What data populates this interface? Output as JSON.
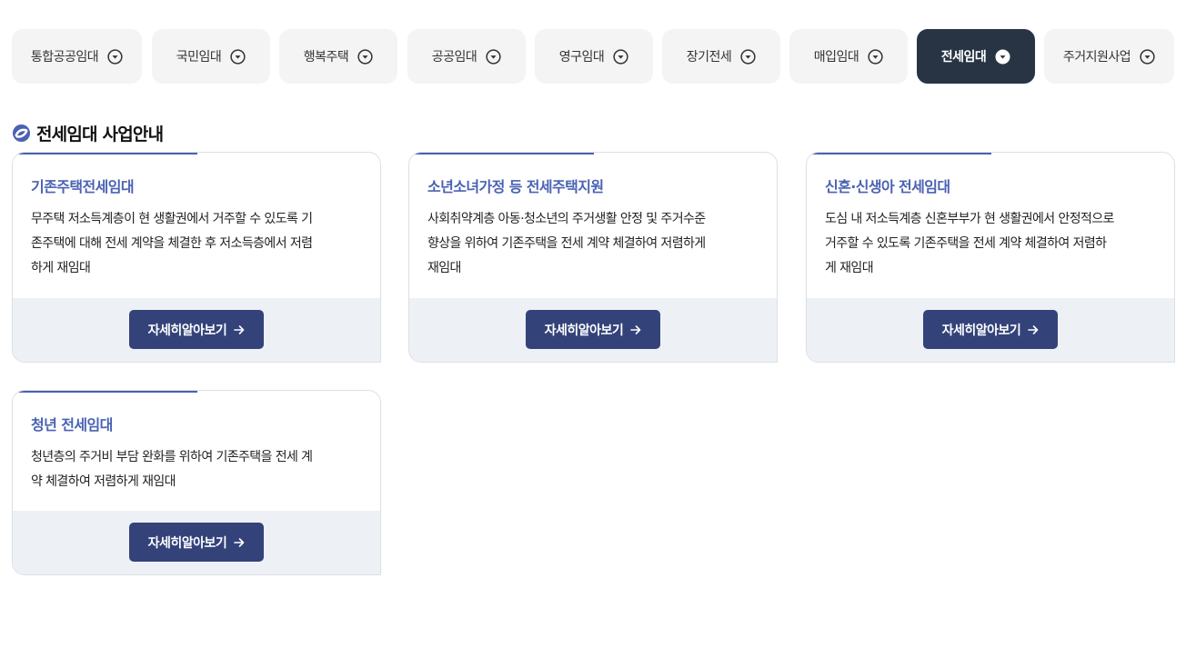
{
  "tabs": [
    {
      "label": "통합공공임대",
      "icon": "chevron-down-circle-icon",
      "active": false
    },
    {
      "label": "국민임대",
      "icon": "chevron-down-circle-icon",
      "active": false
    },
    {
      "label": "행복주택",
      "icon": "chevron-down-circle-icon",
      "active": false
    },
    {
      "label": "공공임대",
      "icon": "chevron-down-circle-icon",
      "active": false
    },
    {
      "label": "영구임대",
      "icon": "chevron-down-circle-icon",
      "active": false
    },
    {
      "label": "장기전세",
      "icon": "chevron-down-circle-icon",
      "active": false
    },
    {
      "label": "매입임대",
      "icon": "chevron-down-circle-icon",
      "active": false
    },
    {
      "label": "전세임대",
      "icon": "chevron-down-circle-icon",
      "active": true
    },
    {
      "label": "주거지원사업",
      "icon": "chevron-down-circle-icon",
      "active": false
    }
  ],
  "section": {
    "title": "전세임대 사업안내",
    "icon": "link-circle-icon"
  },
  "cards": [
    {
      "title": "기존주택전세임대",
      "desc_lines": [
        "무주택 저소득계층이 현 생활권에서 거주할 수 있도록 기",
        "존주택에 대해 전세 계약을 체결한 후 저소득층에서 저렴",
        "하게 재임대"
      ],
      "button_label": "자세히알아보기"
    },
    {
      "title": "소년소녀가정 등 전세주택지원",
      "desc_lines": [
        "사회취약계층 아동·청소년의 주거생활 안정 및 주거수준",
        "향상을 위하여 기존주택을 전세 계약 체결하여 저렴하게",
        "재임대"
      ],
      "button_label": "자세히알아보기"
    },
    {
      "title": "신혼·신생아 전세임대",
      "desc_lines": [
        "도심 내 저소득계층 신혼부부가 현 생활권에서 안정적으로",
        "거주할 수 있도록 기존주택을 전세 계약 체결하여 저렴하",
        "게 재임대"
      ],
      "button_label": "자세히알아보기"
    },
    {
      "title": "청년 전세임대",
      "desc_lines": [
        "청년층의 주거비 부담 완화를 위하여 기존주택을 전세 계",
        "약 체결하여 저렴하게 재임대"
      ],
      "button_label": "자세히알아보기"
    }
  ],
  "colors": {
    "accent": "#4a62b3",
    "button": "#33437a",
    "active_tab": "#283444",
    "tab_bg": "#f4f4f5",
    "card_footer": "#edf0f4"
  }
}
